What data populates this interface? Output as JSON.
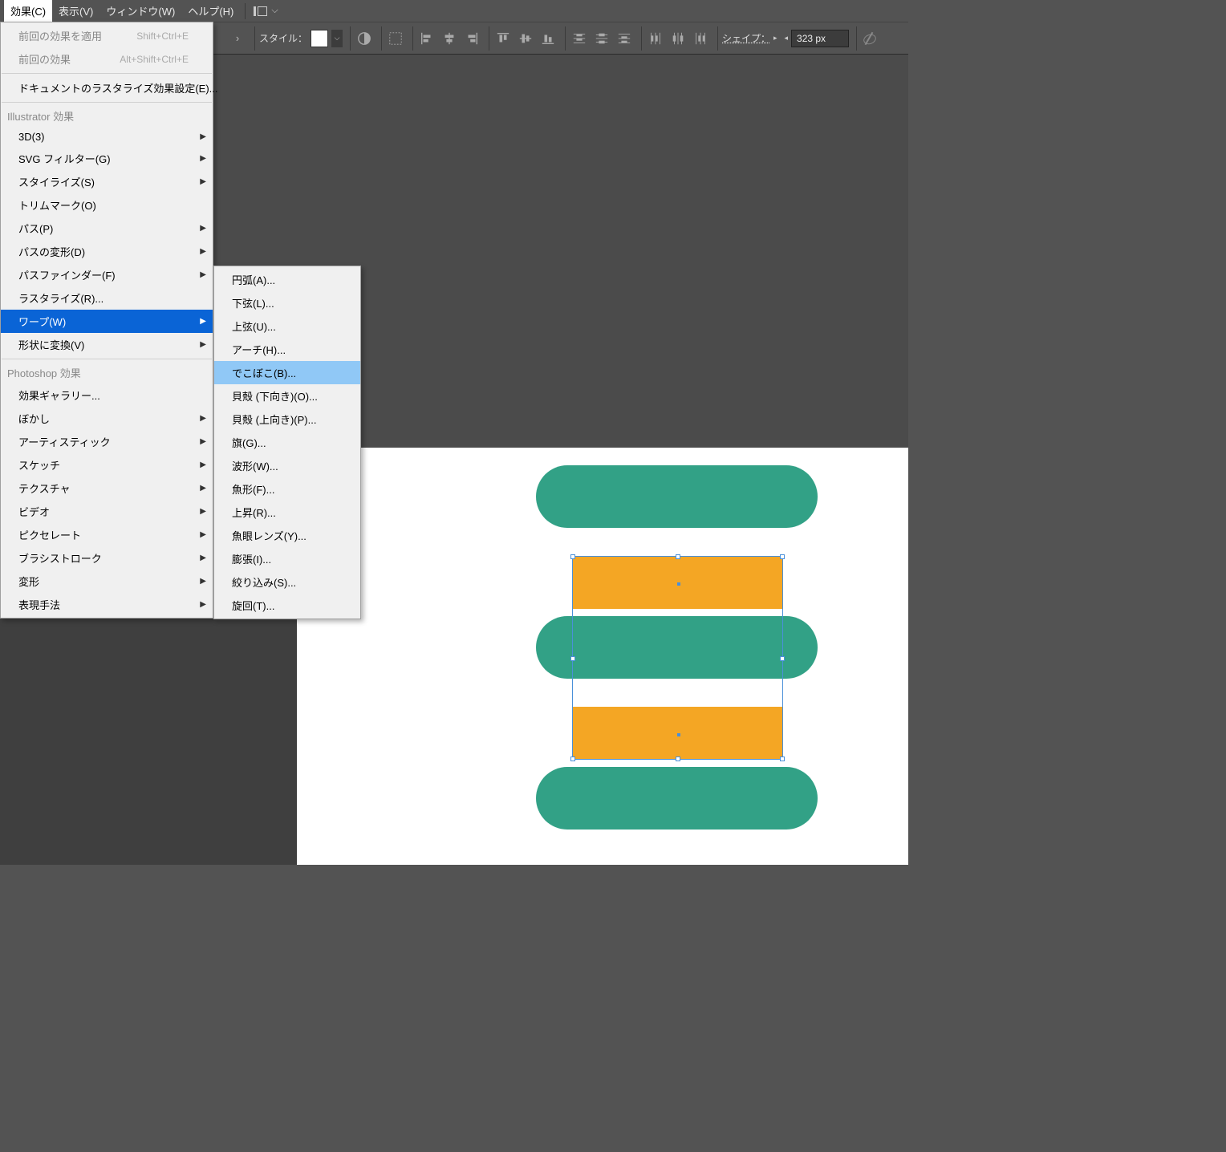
{
  "menubar": {
    "items": [
      {
        "label": "効果(C)",
        "active": true
      },
      {
        "label": "表示(V)",
        "active": false
      },
      {
        "label": "ウィンドウ(W)",
        "active": false
      },
      {
        "label": "ヘルプ(H)",
        "active": false
      }
    ]
  },
  "toolbar": {
    "style_label": "スタイル：",
    "shape_label": "シェイプ：",
    "shape_value": "323 px"
  },
  "menu": {
    "apply_last_effect": {
      "label": "前回の効果を適用",
      "shortcut": "Shift+Ctrl+E"
    },
    "last_effect": {
      "label": "前回の効果",
      "shortcut": "Alt+Shift+Ctrl+E"
    },
    "doc_raster_settings": {
      "label": "ドキュメントのラスタライズ効果設定(E)..."
    },
    "header_illustrator": "Illustrator 効果",
    "items_ai": [
      {
        "label": "3D(3)",
        "sub": true
      },
      {
        "label": "SVG フィルター(G)",
        "sub": true
      },
      {
        "label": "スタイライズ(S)",
        "sub": true
      },
      {
        "label": "トリムマーク(O)",
        "sub": false
      },
      {
        "label": "パス(P)",
        "sub": true
      },
      {
        "label": "パスの変形(D)",
        "sub": true
      },
      {
        "label": "パスファインダー(F)",
        "sub": true
      },
      {
        "label": "ラスタライズ(R)...",
        "sub": false
      },
      {
        "label": "ワープ(W)",
        "sub": true,
        "highlight": true
      },
      {
        "label": "形状に変換(V)",
        "sub": true
      }
    ],
    "header_photoshop": "Photoshop 効果",
    "items_ps": [
      {
        "label": "効果ギャラリー...",
        "sub": false
      },
      {
        "label": "ぼかし",
        "sub": true
      },
      {
        "label": "アーティスティック",
        "sub": true
      },
      {
        "label": "スケッチ",
        "sub": true
      },
      {
        "label": "テクスチャ",
        "sub": true
      },
      {
        "label": "ビデオ",
        "sub": true
      },
      {
        "label": "ピクセレート",
        "sub": true
      },
      {
        "label": "ブラシストローク",
        "sub": true
      },
      {
        "label": "変形",
        "sub": true
      },
      {
        "label": "表現手法",
        "sub": true
      }
    ],
    "submenu": [
      {
        "label": "円弧(A)..."
      },
      {
        "label": "下弦(L)..."
      },
      {
        "label": "上弦(U)..."
      },
      {
        "label": "アーチ(H)..."
      },
      {
        "label": "でこぼこ(B)...",
        "highlight": true
      },
      {
        "label": "貝殻 (下向き)(O)..."
      },
      {
        "label": "貝殻 (上向き)(P)..."
      },
      {
        "label": "旗(G)..."
      },
      {
        "label": "波形(W)..."
      },
      {
        "label": "魚形(F)..."
      },
      {
        "label": "上昇(R)..."
      },
      {
        "label": "魚眼レンズ(Y)..."
      },
      {
        "label": "膨張(I)..."
      },
      {
        "label": "絞り込み(S)..."
      },
      {
        "label": "旋回(T)..."
      }
    ]
  }
}
